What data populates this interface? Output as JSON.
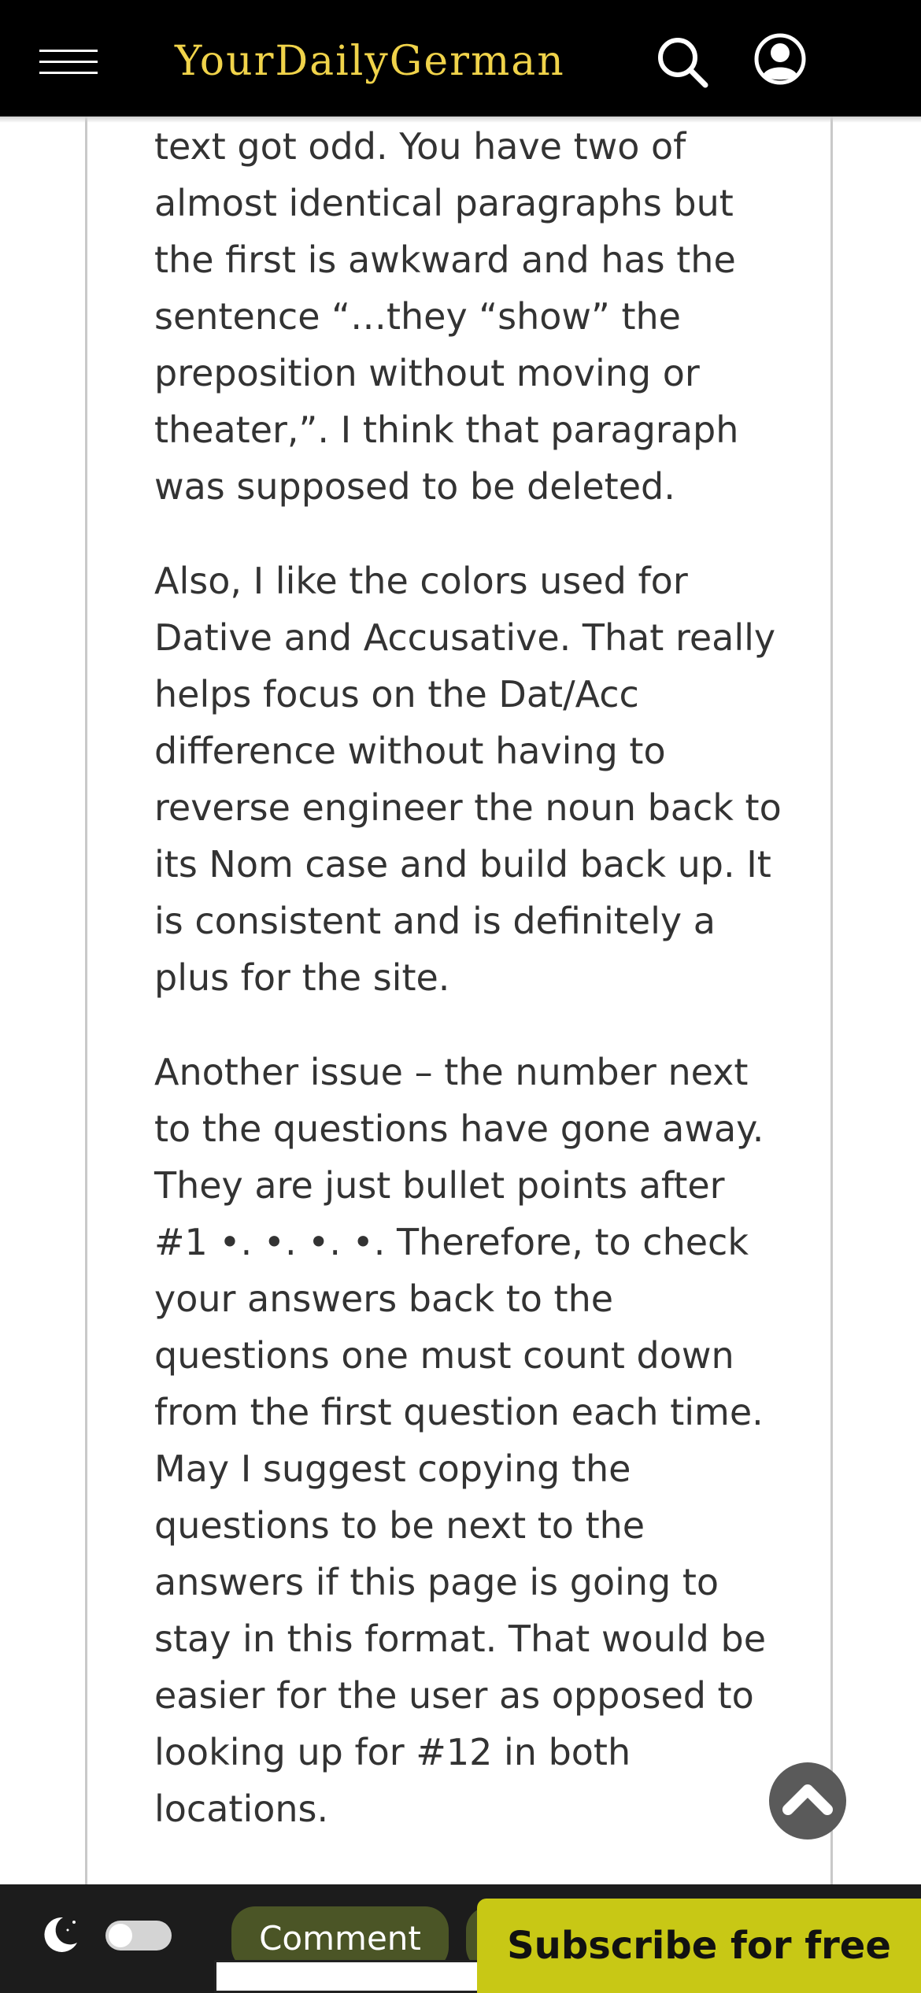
{
  "header": {
    "brand": "YourDailyGerman",
    "icons": {
      "menu": "hamburger-menu-icon",
      "search": "search-icon",
      "account": "user-account-icon"
    },
    "brand_color": "#f0d34a",
    "background": "#000000"
  },
  "comment": {
    "paragraphs": [
      "text got odd. You have two of almost identical paragraphs but the first is awkward and has the sentence “…they “show” the preposition without moving or theater,”. I think that paragraph was supposed to be deleted.",
      "Also, I like the colors used for Dative and Accusative. That really helps focus on the Dat/Acc difference without having to reverse engineer the noun back to its Nom case and build back up. It is consistent and is definitely a plus for the site.",
      "Another issue – the number next to the questions have gone away. They are just bullet points after #1 •. •. •. •. Therefore, to check your answers back to the questions one must count down from the first question each time. May I suggest copying the questions to be next to the answers if this page is going to stay in this format. That would be easier for the user as opposed to looking up for #12 in both locations."
    ]
  },
  "scroll_top": {
    "icon": "chevron-up-icon"
  },
  "bottom_bar": {
    "dark_mode_icon": "moon-icon",
    "dark_mode_enabled": false,
    "comment_label": "Comment",
    "subscribe_label": "Subscribe for free",
    "colors": {
      "comment_button": "#4b5526",
      "subscribe_button": "#c8c815"
    }
  }
}
